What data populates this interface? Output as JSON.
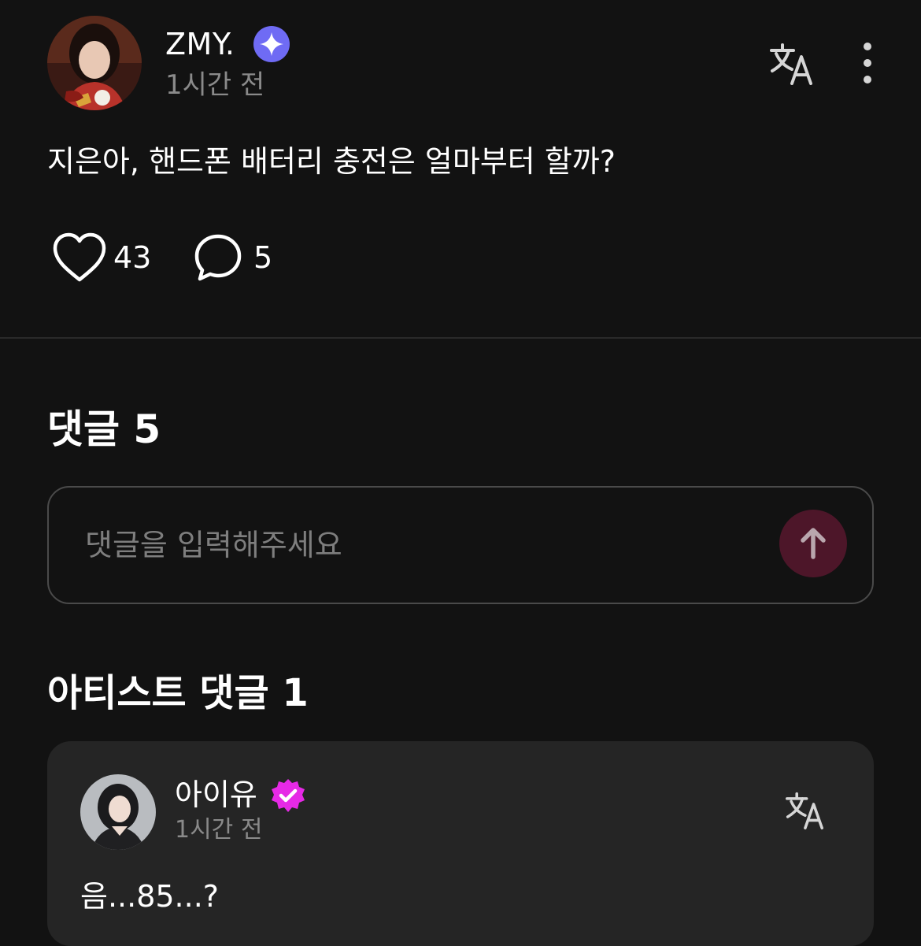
{
  "post": {
    "author_name": "ZMY.",
    "time": "1시간 전",
    "text": "지은아, 핸드폰 배터리 충전은 얼마부터 할까?",
    "like_count": "43",
    "comment_count": "5"
  },
  "comments": {
    "title": "댓글 5",
    "input_placeholder": "댓글을 입력해주세요"
  },
  "artist_comments": {
    "title": "아티스트 댓글 1",
    "items": [
      {
        "author_name": "아이유",
        "time": "1시간 전",
        "text": "음...85...?"
      }
    ]
  },
  "icons": {
    "author_badge": "sparkle-badge-icon",
    "artist_badge": "verified-badge-icon",
    "translate": "translate-icon",
    "more": "more-vertical-icon",
    "like": "heart-icon",
    "comment": "comment-bubble-icon",
    "send": "arrow-up-icon"
  },
  "colors": {
    "background": "#121212",
    "card_background": "#252525",
    "author_badge": "#6f6bf4",
    "artist_badge": "#e629e6",
    "send_button": "#4d1629",
    "muted_text": "#8a8a8a"
  }
}
